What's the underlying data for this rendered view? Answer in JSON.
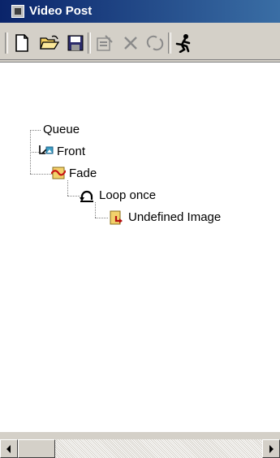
{
  "window": {
    "title": "Video Post"
  },
  "toolbar": {
    "buttons": [
      {
        "icon": "new-document-icon"
      },
      {
        "icon": "open-folder-icon"
      },
      {
        "icon": "save-disk-icon"
      },
      {
        "icon": "edit-properties-icon"
      },
      {
        "icon": "delete-icon"
      },
      {
        "icon": "swap-icon"
      },
      {
        "icon": "execute-sequence-icon"
      }
    ]
  },
  "tree": {
    "root": "Queue",
    "items": [
      {
        "label": "Front",
        "icon": "image-input-icon"
      },
      {
        "label": "Fade",
        "icon": "fade-filter-icon"
      },
      {
        "label": "Loop once",
        "icon": "loop-icon"
      },
      {
        "label": "Undefined Image",
        "icon": "image-output-icon"
      }
    ]
  }
}
